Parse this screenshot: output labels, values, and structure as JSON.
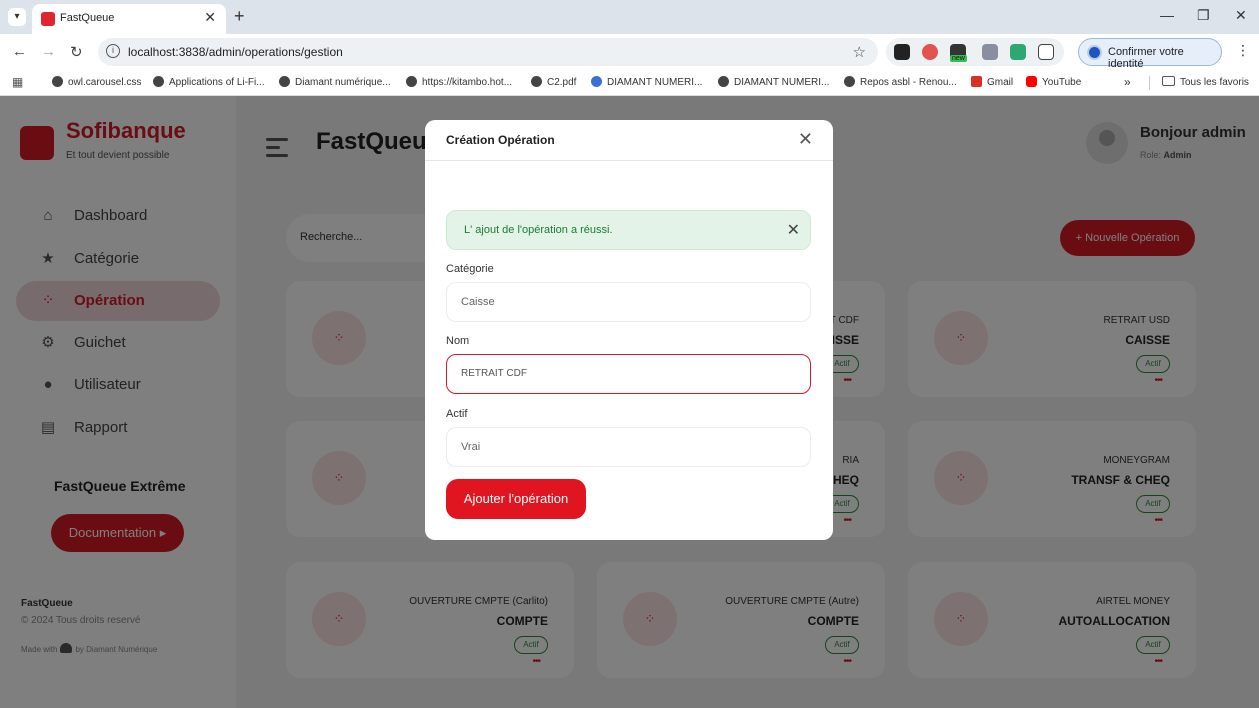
{
  "browser": {
    "tab_title": "FastQueue",
    "url": "localhost:3838/admin/operations/gestion",
    "profile_label": "Confirmer votre identité",
    "ext_badge": "new",
    "bookmarks": [
      "owl.carousel.css",
      "Applications of Li-Fi...",
      "Diamant numérique...",
      "https://kitambo.hot...",
      "C2.pdf",
      "DIAMANT NUMERI...",
      "DIAMANT NUMERI...",
      "Repos asbl - Renou...",
      "Gmail",
      "YouTube"
    ],
    "bookmarks_more": "»",
    "all_bookmarks": "Tous les favoris"
  },
  "sidebar": {
    "brand": "Sofibanque",
    "tagline": "Et tout devient possible",
    "items": [
      {
        "label": "Dashboard",
        "icon": "home-icon",
        "active": false
      },
      {
        "label": "Catégorie",
        "icon": "star-icon",
        "active": false
      },
      {
        "label": "Opération",
        "icon": "grid-dots-icon",
        "active": true
      },
      {
        "label": "Guichet",
        "icon": "gear-icon",
        "active": false
      },
      {
        "label": "Utilisateur",
        "icon": "user-icon",
        "active": false
      },
      {
        "label": "Rapport",
        "icon": "document-icon",
        "active": false
      }
    ],
    "promo_title": "FastQueue Extrême",
    "promo_button": "Documentation ▸",
    "footer_brand": "FastQueue",
    "footer_copy": "© 2024 Tous droits reservé",
    "footer_made_prefix": "Made with",
    "footer_made_suffix": "by Diamant Numérique"
  },
  "header": {
    "title": "FastQueue",
    "greeting": "Bonjour admin",
    "role_label": "Role:",
    "role_value": "Admin"
  },
  "toolbar": {
    "search_placeholder": "Recherche...",
    "new_button": "+ Nouvelle Opération"
  },
  "cards": [
    {
      "name": "",
      "category": "",
      "status": "",
      "menu": ""
    },
    {
      "name": "RETRAIT CDF",
      "category": "CAISSE",
      "status": "Actif",
      "menu": "•••"
    },
    {
      "name": "RETRAIT USD",
      "category": "CAISSE",
      "status": "Actif",
      "menu": "•••"
    },
    {
      "name": "",
      "category": "",
      "status": "",
      "menu": ""
    },
    {
      "name": "RIA",
      "category": "TRANSF & CHEQ",
      "status": "Actif",
      "menu": "•••"
    },
    {
      "name": "MONEYGRAM",
      "category": "TRANSF & CHEQ",
      "status": "Actif",
      "menu": "•••"
    },
    {
      "name": "OUVERTURE CMPTE (Carlito)",
      "category": "COMPTE",
      "status": "Actif",
      "menu": "•••"
    },
    {
      "name": "OUVERTURE CMPTE (Autre)",
      "category": "COMPTE",
      "status": "Actif",
      "menu": "•••"
    },
    {
      "name": "AIRTEL MONEY",
      "category": "AUTOALLOCATION",
      "status": "Actif",
      "menu": "•••"
    }
  ],
  "modal": {
    "title": "Création Opération",
    "alert": "L' ajout de l'opération a réussi.",
    "category_label": "Catégorie",
    "category_value": "Caisse",
    "name_label": "Nom",
    "name_value": "RETRAIT CDF",
    "active_label": "Actif",
    "active_value": "Vrai",
    "submit": "Ajouter l'opération"
  }
}
